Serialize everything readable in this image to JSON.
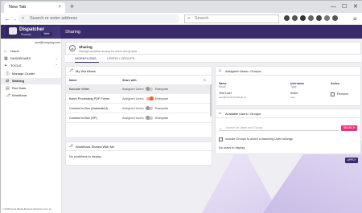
{
  "browser": {
    "tab_title": "New Tab",
    "tab_close": "×",
    "new_tab": "+",
    "address_placeholder": "Search or enter address",
    "search_placeholder": "Search",
    "window_controls": [
      "—",
      "☐",
      "✕"
    ],
    "nav": {
      "back": "←",
      "forward": "→",
      "reload": "⟳"
    }
  },
  "app": {
    "brand": "Dispatcher",
    "brand_sub": "Phoenix",
    "brand_pill": "Web",
    "page_title": "Sharing",
    "user_email": "user@company.com",
    "header_color": "#3b2a6b",
    "accent_pink": "#e9327a",
    "accent_orange": "#f25c2b"
  },
  "sidebar": {
    "items": [
      {
        "label": "Home",
        "icon": "home-icon"
      },
      {
        "label": "DASHBOARD",
        "icon": "dashboard-icon"
      },
      {
        "label": "TOOLS",
        "icon": "tools-icon"
      },
      {
        "label": "Manage Cluster",
        "icon": "cluster-icon"
      },
      {
        "label": "Sharing",
        "icon": "share-icon"
      },
      {
        "label": "Run Data",
        "icon": "data-icon"
      },
      {
        "label": "Workflows",
        "icon": "workflow-icon"
      }
    ],
    "copyright": "© 2018 Konica Minolta Business Solutions U.S.A. Inc."
  },
  "sharing": {
    "title": "Sharing",
    "subtitle": "Manage workflow access for users and groups",
    "tabs": [
      "WORKFLOWS",
      "USERS / GROUPS"
    ],
    "my_workflows": {
      "title": "My Workflows",
      "col_name": "Name",
      "col_share": "Share with",
      "rows": [
        {
          "name": "Barcode Writer",
          "assigned": "Assigned Users",
          "everyone": "Everyone",
          "on": false
        },
        {
          "name": "Batch Processing PDF Forms",
          "assigned": "Assigned Users",
          "everyone": "Everyone",
          "on": true
        },
        {
          "name": "Connect to Box (Automated)",
          "assigned": "Assigned Users",
          "everyone": "Everyone",
          "on": false
        },
        {
          "name": "Connect to Box (HP)",
          "assigned": "Assigned Users",
          "everyone": "Everyone",
          "on": false
        }
      ]
    },
    "shared_with_me": {
      "title": "Workflows Shared With Me",
      "empty": "No workflows to display"
    },
    "assigned": {
      "title": "Assigned Users / Groups",
      "col_name": "Name",
      "col_name_sub": "Email",
      "col_user": "Username",
      "col_user_sub": "Type",
      "col_action": "Action",
      "row": {
        "name": "Test User",
        "email": "user@konicaminoltamfp.us",
        "username": "tester",
        "type": "user",
        "action": "Remove"
      }
    },
    "available": {
      "title": "Available Users / Groups",
      "search_placeholder": "Search for Users and Groups",
      "search_button": "SEARCH",
      "include_label": "Include Groups to which a matching User belongs",
      "empty": "No users to display"
    },
    "apply": "APPLY"
  }
}
